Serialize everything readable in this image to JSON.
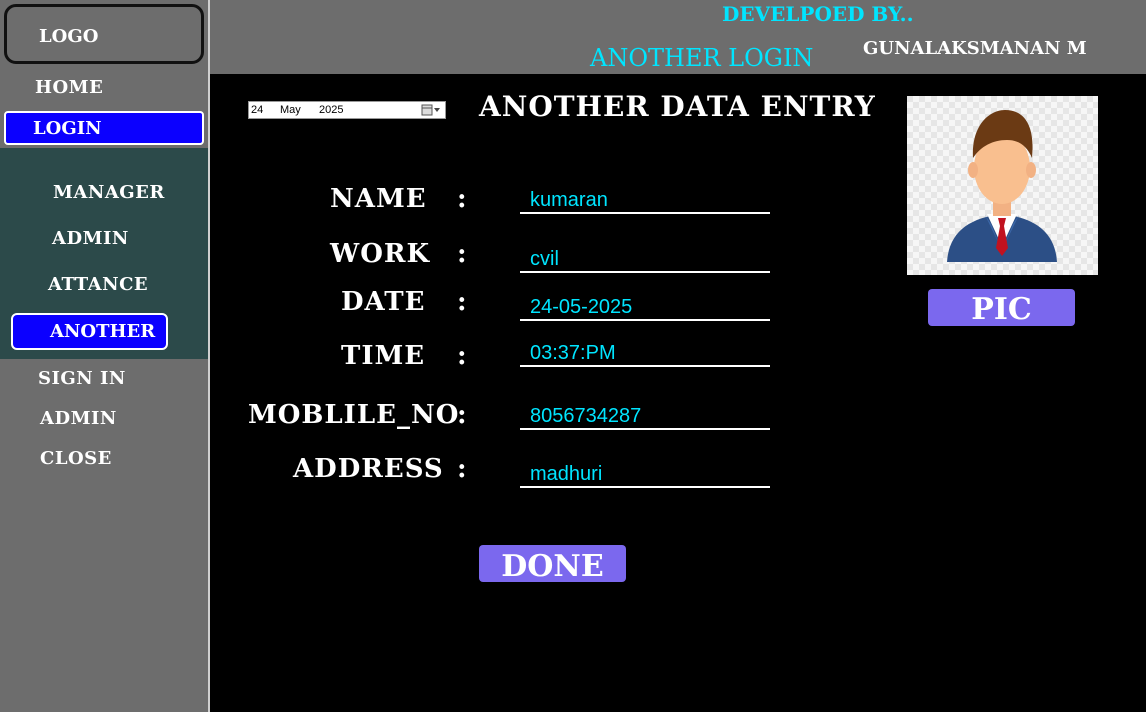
{
  "sidebar": {
    "logo": "LOGO",
    "home": "HOME",
    "login": "LOGIN",
    "submenu": [
      "MANAGER",
      "ADMIN",
      "ATTANCE",
      "ANOTHER"
    ],
    "sign_in": "SIGN IN",
    "admin": "ADMIN",
    "close": "CLOSE"
  },
  "header": {
    "developed_by": "DEVELPOED BY..",
    "page_name": "ANOTHER LOGIN",
    "developer": "GUNALAKSMANAN M"
  },
  "date_picker": {
    "day": "24",
    "month": "May",
    "year": "2025",
    "icon": "calendar-dropdown-icon"
  },
  "form": {
    "title": "ANOTHER DATA ENTRY",
    "separator": ":",
    "fields": [
      {
        "label": "NAME",
        "value": "kumaran"
      },
      {
        "label": "WORK",
        "value": "cvil"
      },
      {
        "label": "DATE",
        "value": "24-05-2025"
      },
      {
        "label": "TIME",
        "value": "03:37:PM"
      },
      {
        "label": "MOBLILE_NO",
        "value": "8056734287"
      },
      {
        "label": "ADDRESS",
        "value": "madhuri"
      }
    ],
    "done_label": "DONE"
  },
  "photo": {
    "icon": "user-avatar-icon",
    "pic_label": "PIC"
  },
  "colors": {
    "background": "#000000",
    "panel_gray": "#6d6d6d",
    "submenu_teal": "#2c4a4a",
    "highlight_blue": "#0b00ff",
    "accent_cyan": "#00e5ff",
    "button_purple": "#7b68ee"
  }
}
